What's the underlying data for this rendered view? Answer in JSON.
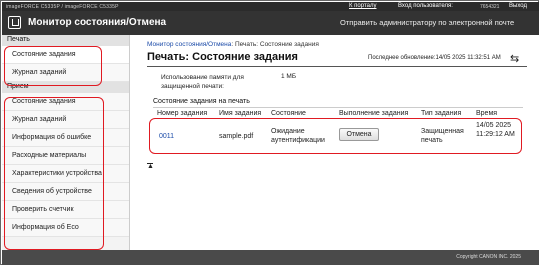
{
  "topbar": {
    "device_name": "imageFORCE C5335P / imageFORCE C5335P",
    "portal_link": "К порталу",
    "login_label": "Вход пользователя:",
    "user_name": "7654321",
    "logout_link": "Выход"
  },
  "titlebar": {
    "title": "Монитор состояния/Отмена",
    "mail_admin": "Отправить администратору по электронной почте"
  },
  "sidebar": {
    "print_header": "Печать",
    "print_items": [
      "Состояние задания",
      "Журнал заданий"
    ],
    "receive_header": "Прием",
    "receive_items": [
      "Состояние задания",
      "Журнал заданий",
      "Информация об ошибке",
      "Расходные материалы",
      "Характеристики устройства",
      "Сведения об устройстве",
      "Проверить счетчик",
      "Информация об Eco"
    ]
  },
  "main": {
    "breadcrumb_link": "Монитор состояния/Отмена",
    "breadcrumb_rest": ": Печать: Состояние задания",
    "heading": "Печать: Состояние задания",
    "last_updated": "Последнее обновление:14/05 2025 11:32:51 AM",
    "memory_label": "Использование памяти для защищенной печати:",
    "memory_value": "1 МБ",
    "section_title": "Состояние задания на печать",
    "columns": [
      "Номер задания",
      "Имя задания",
      "Состояние",
      "Выполнение задания",
      "Тип задания",
      "Время"
    ],
    "row": {
      "number": "0011",
      "name": "sample.pdf",
      "status": "Ожидание аутентификации",
      "action": "Отмена",
      "type": "Защищенная печать",
      "time": "14/05 2025 11:29:12 AM"
    },
    "top_link": "▲"
  },
  "footer": {
    "copyright": "Copyright CANON INC. 2025"
  },
  "colors": {
    "highlight": "#e01a22",
    "titlebar": "#333333",
    "link": "#1a4aa8"
  }
}
